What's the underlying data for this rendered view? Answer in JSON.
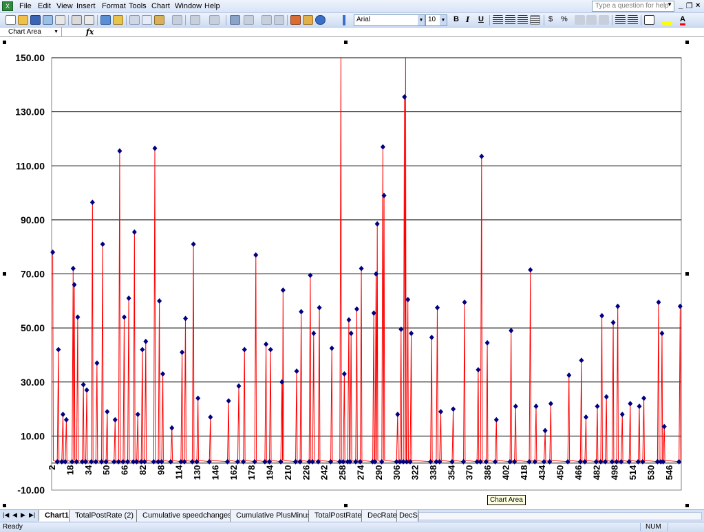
{
  "menubar": {
    "items": [
      "File",
      "Edit",
      "View",
      "Insert",
      "Format",
      "Tools",
      "Chart",
      "Window",
      "Help"
    ],
    "help_placeholder": "Type a question for help"
  },
  "toolbar": {
    "font_name": "Arial",
    "font_size": "10",
    "bold": "B",
    "italic": "I",
    "underline": "U",
    "currency": "$",
    "percent": "%"
  },
  "formulabar": {
    "namebox": "Chart Area",
    "fx": "fx"
  },
  "tooltip": "Chart Area",
  "tabs": [
    "Chart1",
    "TotalPostRate (2)",
    "Cumulative speedchanges",
    "Cumulative PlusMinus",
    "TotalPostRate",
    "DecRate",
    "DecS"
  ],
  "status": {
    "ready": "Ready",
    "num": "NUM"
  },
  "colors": {
    "line": "#ff0000",
    "marker": "#000080",
    "grid": "#000000"
  },
  "chart_data": {
    "type": "line",
    "ylim": [
      -10,
      150
    ],
    "yticks": [
      "150.00",
      "130.00",
      "110.00",
      "90.00",
      "70.00",
      "50.00",
      "30.00",
      "10.00",
      "-10.00"
    ],
    "ytick_values": [
      150,
      130,
      110,
      90,
      70,
      50,
      30,
      10,
      -10
    ],
    "xticks": [
      "2",
      "18",
      "34",
      "50",
      "66",
      "82",
      "98",
      "114",
      "130",
      "146",
      "162",
      "178",
      "194",
      "210",
      "226",
      "242",
      "258",
      "274",
      "290",
      "306",
      "322",
      "338",
      "354",
      "370",
      "386",
      "402",
      "418",
      "434",
      "450",
      "466",
      "482",
      "498",
      "514",
      "530",
      "546"
    ],
    "xlim": [
      2,
      557
    ],
    "peaks": [
      {
        "x": 3,
        "y": 78
      },
      {
        "x": 8,
        "y": 42
      },
      {
        "x": 12,
        "y": 18
      },
      {
        "x": 15,
        "y": 16
      },
      {
        "x": 21,
        "y": 72
      },
      {
        "x": 22,
        "y": 66
      },
      {
        "x": 25,
        "y": 54
      },
      {
        "x": 30,
        "y": 29
      },
      {
        "x": 33,
        "y": 27
      },
      {
        "x": 38,
        "y": 96.5
      },
      {
        "x": 42,
        "y": 37
      },
      {
        "x": 47,
        "y": 81
      },
      {
        "x": 51,
        "y": 19
      },
      {
        "x": 58,
        "y": 16
      },
      {
        "x": 62,
        "y": 115.5
      },
      {
        "x": 66,
        "y": 54
      },
      {
        "x": 70,
        "y": 61
      },
      {
        "x": 75,
        "y": 85.5
      },
      {
        "x": 78,
        "y": 18
      },
      {
        "x": 82,
        "y": 42
      },
      {
        "x": 85,
        "y": 45
      },
      {
        "x": 93,
        "y": 116.5
      },
      {
        "x": 97,
        "y": 60
      },
      {
        "x": 100,
        "y": 33
      },
      {
        "x": 108,
        "y": 13
      },
      {
        "x": 117,
        "y": 41
      },
      {
        "x": 120,
        "y": 53.5
      },
      {
        "x": 127,
        "y": 81
      },
      {
        "x": 131,
        "y": 24
      },
      {
        "x": 142,
        "y": 17
      },
      {
        "x": 158,
        "y": 23
      },
      {
        "x": 167,
        "y": 28.5
      },
      {
        "x": 172,
        "y": 42
      },
      {
        "x": 182,
        "y": 77
      },
      {
        "x": 191,
        "y": 44
      },
      {
        "x": 195,
        "y": 42
      },
      {
        "x": 205,
        "y": 30
      },
      {
        "x": 206,
        "y": 64
      },
      {
        "x": 218,
        "y": 34
      },
      {
        "x": 222,
        "y": 56
      },
      {
        "x": 230,
        "y": 69.5
      },
      {
        "x": 233,
        "y": 48
      },
      {
        "x": 238,
        "y": 57.5
      },
      {
        "x": 249,
        "y": 42.5
      },
      {
        "x": 257,
        "y": 152
      },
      {
        "x": 260,
        "y": 33
      },
      {
        "x": 264,
        "y": 53
      },
      {
        "x": 266,
        "y": 48
      },
      {
        "x": 271,
        "y": 57
      },
      {
        "x": 275,
        "y": 72
      },
      {
        "x": 286,
        "y": 55.5
      },
      {
        "x": 288,
        "y": 70
      },
      {
        "x": 289,
        "y": 88.5
      },
      {
        "x": 294,
        "y": 117
      },
      {
        "x": 295,
        "y": 99
      },
      {
        "x": 307,
        "y": 18
      },
      {
        "x": 310,
        "y": 49.5
      },
      {
        "x": 313,
        "y": 135.5
      },
      {
        "x": 314,
        "y": 152
      },
      {
        "x": 316,
        "y": 60.5
      },
      {
        "x": 319,
        "y": 48
      },
      {
        "x": 337,
        "y": 46.5
      },
      {
        "x": 342,
        "y": 57.5
      },
      {
        "x": 345,
        "y": 19
      },
      {
        "x": 356,
        "y": 20
      },
      {
        "x": 366,
        "y": 59.5
      },
      {
        "x": 378,
        "y": 34.5
      },
      {
        "x": 381,
        "y": 113.5
      },
      {
        "x": 386,
        "y": 44.5
      },
      {
        "x": 394,
        "y": 16
      },
      {
        "x": 407,
        "y": 49
      },
      {
        "x": 411,
        "y": 21
      },
      {
        "x": 424,
        "y": 71.5
      },
      {
        "x": 429,
        "y": 21
      },
      {
        "x": 437,
        "y": 12
      },
      {
        "x": 442,
        "y": 22
      },
      {
        "x": 458,
        "y": 32.5
      },
      {
        "x": 469,
        "y": 38
      },
      {
        "x": 473,
        "y": 17
      },
      {
        "x": 483,
        "y": 21
      },
      {
        "x": 487,
        "y": 54.5
      },
      {
        "x": 491,
        "y": 24.5
      },
      {
        "x": 497,
        "y": 52
      },
      {
        "x": 501,
        "y": 58
      },
      {
        "x": 505,
        "y": 18
      },
      {
        "x": 512,
        "y": 22
      },
      {
        "x": 520,
        "y": 21
      },
      {
        "x": 524,
        "y": 24
      },
      {
        "x": 537,
        "y": 59.5
      },
      {
        "x": 540,
        "y": 48
      },
      {
        "x": 542,
        "y": 13.5
      },
      {
        "x": 556,
        "y": 58
      }
    ]
  }
}
